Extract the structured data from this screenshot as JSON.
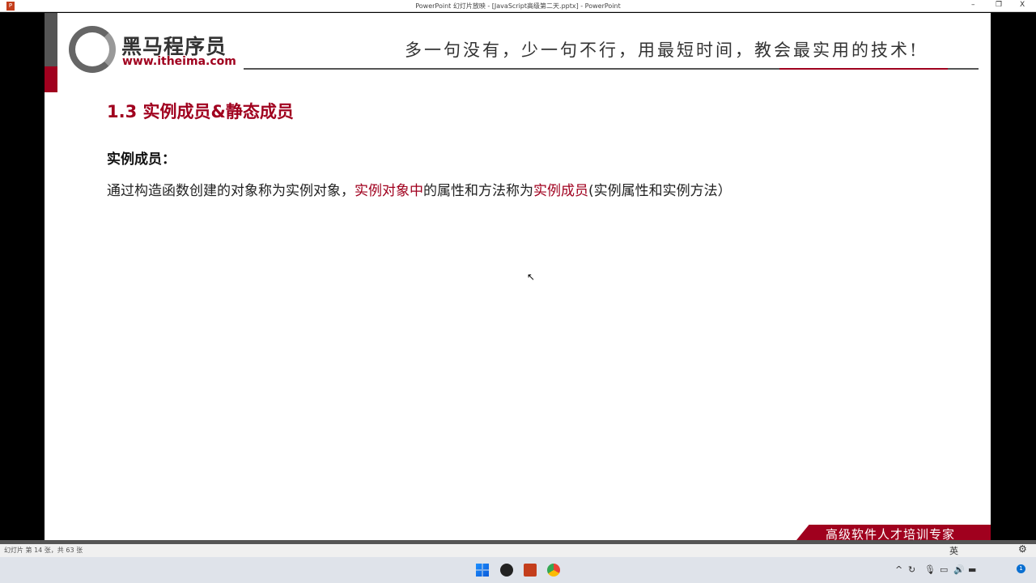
{
  "window": {
    "title": "PowerPoint 幻灯片放映 - [JavaScript高级第二天.pptx] - PowerPoint",
    "minimize": "–",
    "restore": "❐",
    "close": "X"
  },
  "slide": {
    "logo": {
      "name": "黑马程序员",
      "url": "www.itheima.com"
    },
    "slogan": "多一句没有，少一句不行，用最短时间，教会最实用的技术!",
    "heading": "1.3 实例成员&静态成员",
    "subheading": "实例成员：",
    "body": {
      "p1": "通过构造函数创建的对象称为实例对象，",
      "r1": "实例对象中",
      "p2": "的属性和方法称为",
      "r2": "实例成员",
      "p3": "(实例属性和实例方法）"
    },
    "banner": "高级软件人才培训专家"
  },
  "status": {
    "text": "幻灯片 第 14 张，共 63 张"
  },
  "tray": {
    "ime": "英"
  },
  "colors": {
    "accent": "#a0001e"
  }
}
